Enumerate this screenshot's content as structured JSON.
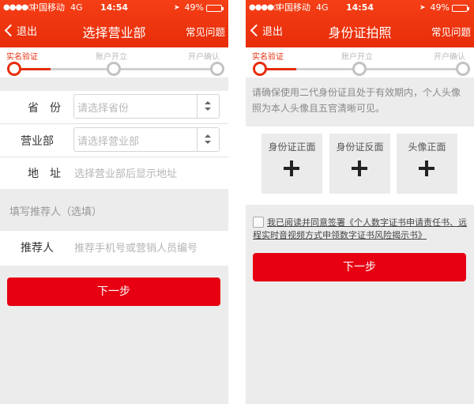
{
  "status": {
    "dots": "●●●●○",
    "carrier": "中国移动",
    "network": "4G",
    "time": "14:54",
    "battery": "49%",
    "battery_level": 0.49
  },
  "steps": [
    "实名验证",
    "账户开立",
    "开户确认"
  ],
  "colors": {
    "brand": "#e72d0a",
    "button": "#e60012",
    "step_inactive": "#c2c2c2"
  },
  "left": {
    "nav": {
      "back": "退出",
      "title": "选择营业部",
      "faq": "常见问题"
    },
    "form": {
      "province": {
        "label": "省　份",
        "placeholder": "请选择省份"
      },
      "branch": {
        "label": "营业部",
        "placeholder": "请选择营业部"
      },
      "address": {
        "label": "地　址",
        "placeholder": "选择营业部后显示地址"
      }
    },
    "referrer_section": "填写推荐人（选填）",
    "referrer": {
      "label": "推荐人",
      "placeholder": "推荐手机号或营销人员编号"
    },
    "next": "下一步"
  },
  "right": {
    "nav": {
      "back": "退出",
      "title": "身份证拍照",
      "faq": "常见问题"
    },
    "notice": "请确保使用二代身份证且处于有效期内，个人头像照为本人头像且五官清晰可见。",
    "uploads": [
      "身份证正面",
      "身份证反面",
      "头像正面"
    ],
    "agreement_lead": "我已阅读并同意签署",
    "agreement_link": "《个人数字证书申请责任书、远程实时音视频方式申领数字证书风险揭示书》",
    "next": "下一步"
  }
}
